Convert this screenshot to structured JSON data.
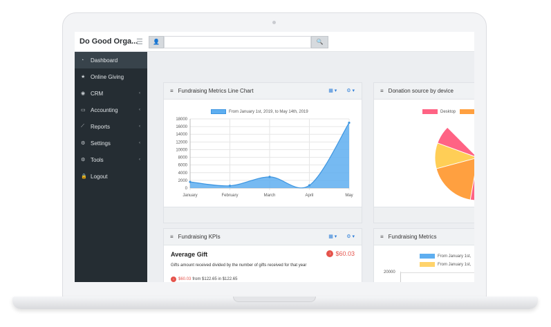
{
  "app": {
    "brand": "Do Good Orga...",
    "search": {
      "value": "",
      "placeholder": ""
    }
  },
  "icons": {
    "hamburger": "☰",
    "user": "👤",
    "search": "🔍"
  },
  "sidebar": {
    "items": [
      {
        "label": "Dashboard",
        "icon": "dashboard-icon",
        "glyph": "◔",
        "active": true,
        "caret": ""
      },
      {
        "label": "Online Giving",
        "icon": "star-icon",
        "glyph": "★",
        "active": false,
        "caret": ""
      },
      {
        "label": "CRM",
        "icon": "user-circle-icon",
        "glyph": "◉",
        "active": false,
        "caret": "‹"
      },
      {
        "label": "Accounting",
        "icon": "credit-card-icon",
        "glyph": "▭",
        "active": false,
        "caret": "‹"
      },
      {
        "label": "Reports",
        "icon": "line-chart-icon",
        "glyph": "⟋",
        "active": false,
        "caret": "‹"
      },
      {
        "label": "Settings",
        "icon": "cogs-icon",
        "glyph": "⚙",
        "active": false,
        "caret": "‹"
      },
      {
        "label": "Tools",
        "icon": "tools-icon",
        "glyph": "⚙",
        "active": false,
        "caret": "‹"
      },
      {
        "label": "Logout",
        "icon": "lock-icon",
        "glyph": "🔒",
        "active": false,
        "caret": ""
      }
    ]
  },
  "panels": {
    "line_chart": {
      "title": "Fundraising Metrics Line Chart",
      "menu_icon": "≡",
      "grid_tool": "▦ ▾",
      "gear_tool": "⚙ ▾"
    },
    "donation_source": {
      "title": "Donation source by device",
      "menu_icon": "≡"
    },
    "kpis": {
      "title": "Fundraising KPIs",
      "menu_icon": "≡",
      "grid_tool": "▦ ▾",
      "gear_tool": "⚙ ▾",
      "kpi_title": "Average Gift",
      "kpi_value": "$60.03",
      "down_glyph": "↓",
      "kpi_desc": "Gifts amount received divided by the number of gifts received for that year",
      "change_value": "$60.03",
      "change_text": "from $122.65 in $122.65"
    },
    "metrics": {
      "title": "Fundraising Metrics",
      "menu_icon": "≡",
      "legend": [
        "From January 1st,",
        "From January 1st,"
      ],
      "y_tick": "20000"
    }
  },
  "chart_data": [
    {
      "type": "area",
      "categories": [
        "January",
        "February",
        "March",
        "April",
        "May"
      ],
      "series": [
        {
          "name": "From January 1st, 2019, to May 14th, 2019",
          "color": "#5eaef0",
          "values": [
            1600,
            600,
            2900,
            700,
            17000
          ]
        }
      ],
      "ylim": [
        0,
        18000
      ],
      "yticks": [
        0,
        2000,
        4000,
        6000,
        8000,
        10000,
        12000,
        14000,
        16000,
        18000
      ],
      "grid": true,
      "legend_position": "top-center"
    },
    {
      "type": "pie",
      "legend": [
        {
          "label": "Desktop",
          "color": "#ff6384"
        },
        {
          "label": "",
          "color": "#ffa040"
        }
      ],
      "slices_visible": [
        {
          "label": "Desktop",
          "color": "#ff6384"
        },
        {
          "label": "",
          "color": "#ffa040"
        },
        {
          "label": "",
          "color": "#ffce56"
        }
      ]
    }
  ]
}
